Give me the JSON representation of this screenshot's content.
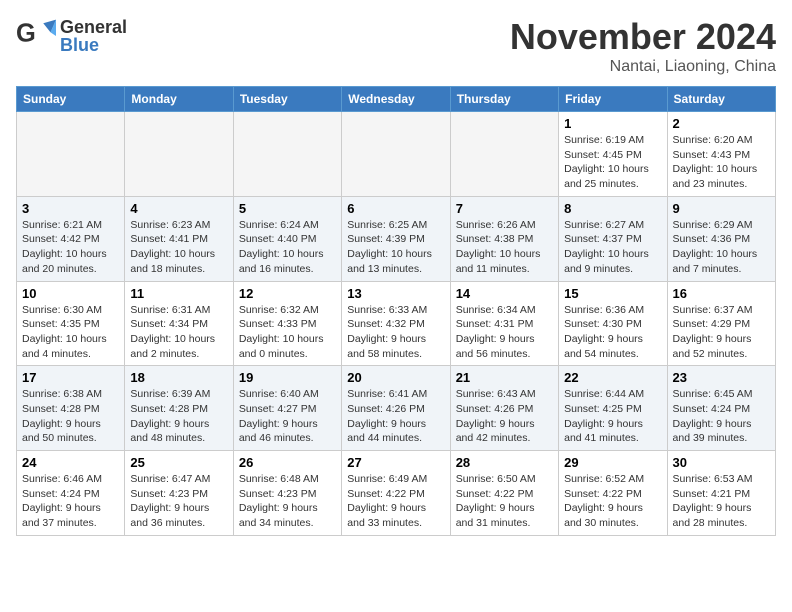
{
  "header": {
    "logo_general": "General",
    "logo_blue": "Blue",
    "month_title": "November 2024",
    "location": "Nantai, Liaoning, China"
  },
  "weekdays": [
    "Sunday",
    "Monday",
    "Tuesday",
    "Wednesday",
    "Thursday",
    "Friday",
    "Saturday"
  ],
  "weeks": [
    [
      {
        "day": "",
        "sunrise": "",
        "sunset": "",
        "daylight": "",
        "empty": true
      },
      {
        "day": "",
        "sunrise": "",
        "sunset": "",
        "daylight": "",
        "empty": true
      },
      {
        "day": "",
        "sunrise": "",
        "sunset": "",
        "daylight": "",
        "empty": true
      },
      {
        "day": "",
        "sunrise": "",
        "sunset": "",
        "daylight": "",
        "empty": true
      },
      {
        "day": "",
        "sunrise": "",
        "sunset": "",
        "daylight": "",
        "empty": true
      },
      {
        "day": "1",
        "sunrise": "Sunrise: 6:19 AM",
        "sunset": "Sunset: 4:45 PM",
        "daylight": "Daylight: 10 hours and 25 minutes.",
        "empty": false
      },
      {
        "day": "2",
        "sunrise": "Sunrise: 6:20 AM",
        "sunset": "Sunset: 4:43 PM",
        "daylight": "Daylight: 10 hours and 23 minutes.",
        "empty": false
      }
    ],
    [
      {
        "day": "3",
        "sunrise": "Sunrise: 6:21 AM",
        "sunset": "Sunset: 4:42 PM",
        "daylight": "Daylight: 10 hours and 20 minutes.",
        "empty": false
      },
      {
        "day": "4",
        "sunrise": "Sunrise: 6:23 AM",
        "sunset": "Sunset: 4:41 PM",
        "daylight": "Daylight: 10 hours and 18 minutes.",
        "empty": false
      },
      {
        "day": "5",
        "sunrise": "Sunrise: 6:24 AM",
        "sunset": "Sunset: 4:40 PM",
        "daylight": "Daylight: 10 hours and 16 minutes.",
        "empty": false
      },
      {
        "day": "6",
        "sunrise": "Sunrise: 6:25 AM",
        "sunset": "Sunset: 4:39 PM",
        "daylight": "Daylight: 10 hours and 13 minutes.",
        "empty": false
      },
      {
        "day": "7",
        "sunrise": "Sunrise: 6:26 AM",
        "sunset": "Sunset: 4:38 PM",
        "daylight": "Daylight: 10 hours and 11 minutes.",
        "empty": false
      },
      {
        "day": "8",
        "sunrise": "Sunrise: 6:27 AM",
        "sunset": "Sunset: 4:37 PM",
        "daylight": "Daylight: 10 hours and 9 minutes.",
        "empty": false
      },
      {
        "day": "9",
        "sunrise": "Sunrise: 6:29 AM",
        "sunset": "Sunset: 4:36 PM",
        "daylight": "Daylight: 10 hours and 7 minutes.",
        "empty": false
      }
    ],
    [
      {
        "day": "10",
        "sunrise": "Sunrise: 6:30 AM",
        "sunset": "Sunset: 4:35 PM",
        "daylight": "Daylight: 10 hours and 4 minutes.",
        "empty": false
      },
      {
        "day": "11",
        "sunrise": "Sunrise: 6:31 AM",
        "sunset": "Sunset: 4:34 PM",
        "daylight": "Daylight: 10 hours and 2 minutes.",
        "empty": false
      },
      {
        "day": "12",
        "sunrise": "Sunrise: 6:32 AM",
        "sunset": "Sunset: 4:33 PM",
        "daylight": "Daylight: 10 hours and 0 minutes.",
        "empty": false
      },
      {
        "day": "13",
        "sunrise": "Sunrise: 6:33 AM",
        "sunset": "Sunset: 4:32 PM",
        "daylight": "Daylight: 9 hours and 58 minutes.",
        "empty": false
      },
      {
        "day": "14",
        "sunrise": "Sunrise: 6:34 AM",
        "sunset": "Sunset: 4:31 PM",
        "daylight": "Daylight: 9 hours and 56 minutes.",
        "empty": false
      },
      {
        "day": "15",
        "sunrise": "Sunrise: 6:36 AM",
        "sunset": "Sunset: 4:30 PM",
        "daylight": "Daylight: 9 hours and 54 minutes.",
        "empty": false
      },
      {
        "day": "16",
        "sunrise": "Sunrise: 6:37 AM",
        "sunset": "Sunset: 4:29 PM",
        "daylight": "Daylight: 9 hours and 52 minutes.",
        "empty": false
      }
    ],
    [
      {
        "day": "17",
        "sunrise": "Sunrise: 6:38 AM",
        "sunset": "Sunset: 4:28 PM",
        "daylight": "Daylight: 9 hours and 50 minutes.",
        "empty": false
      },
      {
        "day": "18",
        "sunrise": "Sunrise: 6:39 AM",
        "sunset": "Sunset: 4:28 PM",
        "daylight": "Daylight: 9 hours and 48 minutes.",
        "empty": false
      },
      {
        "day": "19",
        "sunrise": "Sunrise: 6:40 AM",
        "sunset": "Sunset: 4:27 PM",
        "daylight": "Daylight: 9 hours and 46 minutes.",
        "empty": false
      },
      {
        "day": "20",
        "sunrise": "Sunrise: 6:41 AM",
        "sunset": "Sunset: 4:26 PM",
        "daylight": "Daylight: 9 hours and 44 minutes.",
        "empty": false
      },
      {
        "day": "21",
        "sunrise": "Sunrise: 6:43 AM",
        "sunset": "Sunset: 4:26 PM",
        "daylight": "Daylight: 9 hours and 42 minutes.",
        "empty": false
      },
      {
        "day": "22",
        "sunrise": "Sunrise: 6:44 AM",
        "sunset": "Sunset: 4:25 PM",
        "daylight": "Daylight: 9 hours and 41 minutes.",
        "empty": false
      },
      {
        "day": "23",
        "sunrise": "Sunrise: 6:45 AM",
        "sunset": "Sunset: 4:24 PM",
        "daylight": "Daylight: 9 hours and 39 minutes.",
        "empty": false
      }
    ],
    [
      {
        "day": "24",
        "sunrise": "Sunrise: 6:46 AM",
        "sunset": "Sunset: 4:24 PM",
        "daylight": "Daylight: 9 hours and 37 minutes.",
        "empty": false
      },
      {
        "day": "25",
        "sunrise": "Sunrise: 6:47 AM",
        "sunset": "Sunset: 4:23 PM",
        "daylight": "Daylight: 9 hours and 36 minutes.",
        "empty": false
      },
      {
        "day": "26",
        "sunrise": "Sunrise: 6:48 AM",
        "sunset": "Sunset: 4:23 PM",
        "daylight": "Daylight: 9 hours and 34 minutes.",
        "empty": false
      },
      {
        "day": "27",
        "sunrise": "Sunrise: 6:49 AM",
        "sunset": "Sunset: 4:22 PM",
        "daylight": "Daylight: 9 hours and 33 minutes.",
        "empty": false
      },
      {
        "day": "28",
        "sunrise": "Sunrise: 6:50 AM",
        "sunset": "Sunset: 4:22 PM",
        "daylight": "Daylight: 9 hours and 31 minutes.",
        "empty": false
      },
      {
        "day": "29",
        "sunrise": "Sunrise: 6:52 AM",
        "sunset": "Sunset: 4:22 PM",
        "daylight": "Daylight: 9 hours and 30 minutes.",
        "empty": false
      },
      {
        "day": "30",
        "sunrise": "Sunrise: 6:53 AM",
        "sunset": "Sunset: 4:21 PM",
        "daylight": "Daylight: 9 hours and 28 minutes.",
        "empty": false
      }
    ]
  ]
}
